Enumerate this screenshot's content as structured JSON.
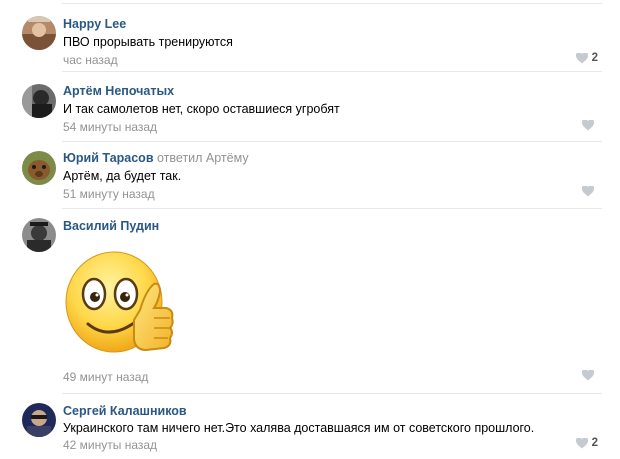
{
  "comments": [
    {
      "author": "Happy Lee",
      "reply_note": "",
      "text": "ПВО прорывать тренируются",
      "time": "час назад",
      "likes": "2",
      "avatar": "avatar-happy-lee"
    },
    {
      "author": "Артём Непочатых",
      "reply_note": "",
      "text": "И так самолетов нет, скоро оставшиеся угробят",
      "time": "54 минуты назад",
      "likes": "",
      "avatar": "avatar-artem"
    },
    {
      "author": "Юрий Тарасов",
      "reply_note": "ответил Артёму",
      "text": "Артём, да будет так.",
      "time": "51 минуту назад",
      "likes": "",
      "avatar": "avatar-yuri"
    },
    {
      "author": "Василий Пудин",
      "reply_note": "",
      "text": "",
      "time": "49 минут назад",
      "likes": "",
      "avatar": "avatar-vasily",
      "sticker": "thumbs-up-smiley-sticker"
    },
    {
      "author": "Сергей Калашников",
      "reply_note": "",
      "text": "Украинского там ничего нет.Это халява доставшаяся им от советского прошлого.",
      "time": "42 минуты назад",
      "likes": "2",
      "avatar": "avatar-sergey"
    }
  ],
  "colors": {
    "author": "#2a5885",
    "meta": "#939393",
    "divider": "#e7e8ec",
    "heart": "#c5cad1"
  },
  "icons": {
    "like": "heart-icon"
  }
}
